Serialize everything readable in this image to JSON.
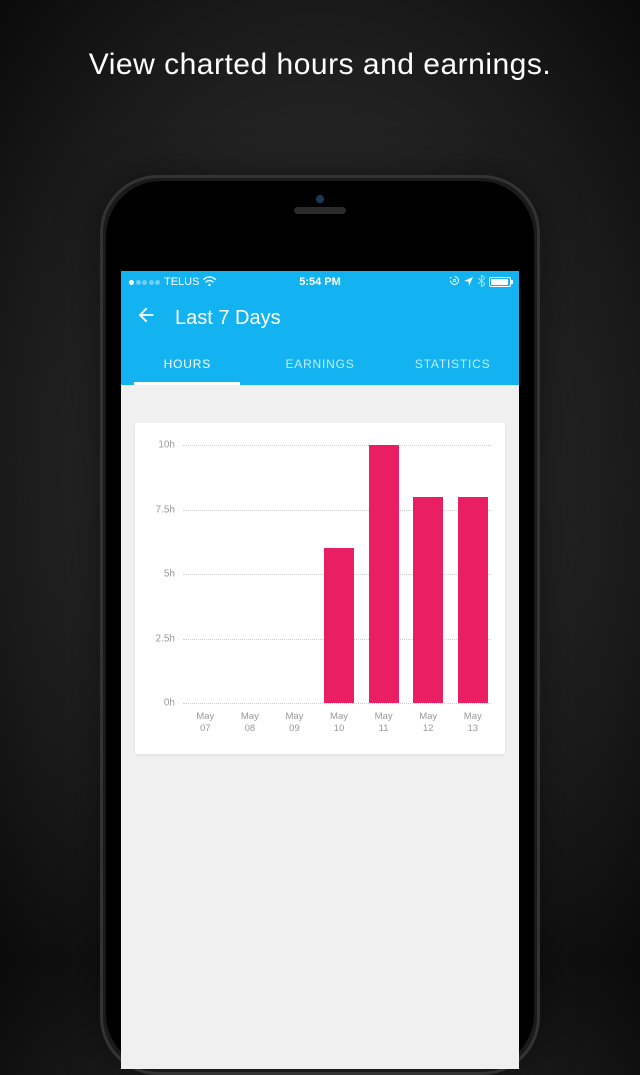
{
  "promo": {
    "headline": "View charted hours and earnings."
  },
  "status_bar": {
    "carrier": "TELUS",
    "time": "5:54 PM"
  },
  "nav": {
    "title": "Last 7 Days"
  },
  "tabs": {
    "items": [
      {
        "label": "HOURS",
        "active": true
      },
      {
        "label": "EARNINGS",
        "active": false
      },
      {
        "label": "STATISTICS",
        "active": false
      }
    ]
  },
  "chart_data": {
    "type": "bar",
    "categories": [
      "May 07",
      "May 08",
      "May 09",
      "May 10",
      "May 11",
      "May 12",
      "May 13"
    ],
    "values": [
      0,
      0,
      0,
      6,
      10,
      8,
      8
    ],
    "y_ticks": [
      0,
      2.5,
      5,
      7.5,
      10
    ],
    "y_tick_labels": [
      "0h",
      "2.5h",
      "5h",
      "7.5h",
      "10h"
    ],
    "title": "",
    "xlabel": "",
    "ylabel": "",
    "ylim": [
      0,
      10
    ],
    "bar_color": "#e91e63"
  }
}
